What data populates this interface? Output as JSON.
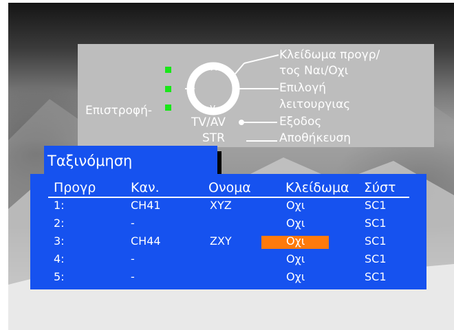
{
  "help": {
    "lock_line1": "Κλείδωμα προγρ/",
    "lock_line2": "τος Ναι/Οχι",
    "select_line1": "Επιλογή",
    "select_line2": "λειτουργιας",
    "back_label": "Επιστροφή-",
    "tvav_label": "TV/AV",
    "exit_label": "Εξοδος",
    "str_label": "STR",
    "save_label": "Αποθήκευση",
    "arrow_up": "^",
    "arrow_down": "v",
    "arrow_plus": "+",
    "arrow_minus": "-"
  },
  "title": "Ταξινόμηση",
  "table": {
    "columns": [
      "Προγρ",
      "Καν.",
      "Ονομα",
      "Κλείδωμα",
      "Σύστ"
    ],
    "rows": [
      {
        "prog": "1:",
        "channel": "CH41",
        "name": "XYZ",
        "lock": "Οχι",
        "system": "SC1"
      },
      {
        "prog": "2:",
        "channel": "-",
        "name": "",
        "lock": "Οχι",
        "system": "SC1"
      },
      {
        "prog": "3:",
        "channel": "CH44",
        "name": "ZXY",
        "lock": "Οχι",
        "system": "SC1"
      },
      {
        "prog": "4:",
        "channel": "-",
        "name": "",
        "lock": "Οχι",
        "system": "SC1"
      },
      {
        "prog": "5:",
        "channel": "-",
        "name": "",
        "lock": "Οχι",
        "system": "SC1"
      }
    ],
    "selected_row": 3
  },
  "colors": {
    "menu_blue": "#1652ef",
    "help_gray": "#bdbdbd",
    "highlight_orange": "#ff7a0c",
    "led_green": "#19e619"
  }
}
